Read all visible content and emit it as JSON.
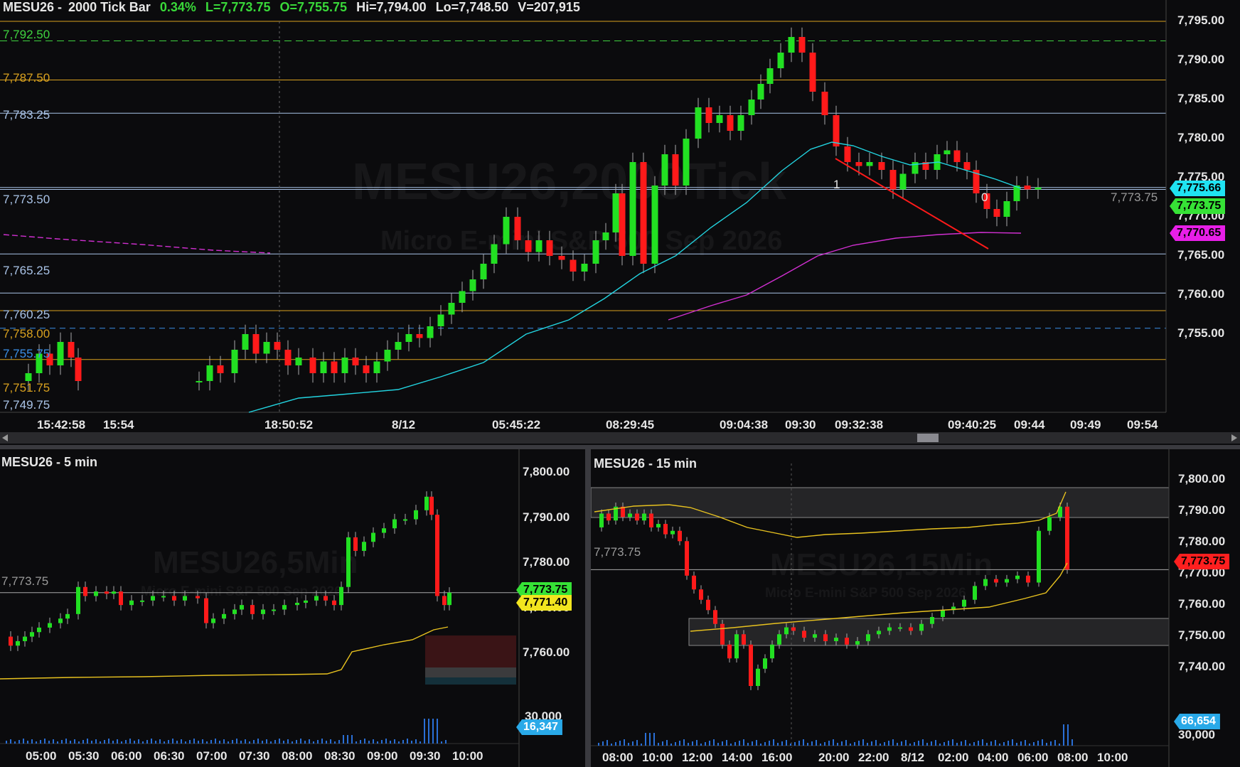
{
  "main": {
    "symbol": "MESU26",
    "interval": "2000 Tick Bar",
    "change_pct": "0.34%",
    "last": "L=7,773.75",
    "open": "O=7,755.75",
    "high": "Hi=7,794.00",
    "low": "Lo=7,748.50",
    "volume": "V=207,915",
    "watermark_title": "MESU26,2000Tick",
    "watermark_sub": "Micro E-mini S&P 500 Sep 2026",
    "y_ticks": [
      "7,795.00",
      "7,790.00",
      "7,785.00",
      "7,780.00",
      "7,775.00",
      "7,770.00",
      "7,765.00",
      "7,760.00",
      "7,755.00"
    ],
    "x_ticks": [
      "15:42:58",
      "15:54",
      "18:50:52",
      "8/12",
      "05:45:22",
      "08:29:45",
      "09:04:38",
      "09:30",
      "09:32:38",
      "09:40:25",
      "09:44",
      "09:49",
      "09:54"
    ],
    "levels": [
      {
        "label": "7,792.50",
        "color": "#3fd33f"
      },
      {
        "label": "7,787.50",
        "color": "#d9a11f"
      },
      {
        "label": "7,783.25",
        "color": "#aac4e8"
      },
      {
        "label": "7,773.50",
        "color": "#aac4e8"
      },
      {
        "label": "7,765.25",
        "color": "#aac4e8"
      },
      {
        "label": "7,760.25",
        "color": "#aac4e8"
      },
      {
        "label": "7,758.00",
        "color": "#d9a11f"
      },
      {
        "label": "7,755.75",
        "color": "#3b8fe8"
      },
      {
        "label": "7,751.75",
        "color": "#d9a11f"
      },
      {
        "label": "7,749.75",
        "color": "#aac4e8"
      }
    ],
    "last_price_text": "7,773.75",
    "tag_cyan": "7,775.66",
    "tag_green": "7,773.75",
    "tag_magenta": "7,770.65",
    "swing_labels": [
      "1",
      "0"
    ]
  },
  "left": {
    "title": "MESU26 - 5 min",
    "watermark_title": "MESU26,5Min",
    "watermark_sub": "Micro E-mini S&P 500 Sep 2026",
    "y_ticks": [
      "7,800.00",
      "7,790.00",
      "7,780.00",
      "7,770.00",
      "7,760.00"
    ],
    "vol_tick": "30,000",
    "x_ticks": [
      "05:00",
      "05:30",
      "06:00",
      "06:30",
      "07:00",
      "07:30",
      "08:00",
      "08:30",
      "09:00",
      "09:30",
      "10:00"
    ],
    "price_line_label": "7,773.75",
    "tag_green": "7,773.75",
    "tag_yellow": "7,771.40",
    "tag_vol": "16,347"
  },
  "right": {
    "title": "MESU26 - 15 min",
    "watermark_title": "MESU26,15Min",
    "watermark_sub": "Micro E-mini S&P 500 Sep 2026",
    "y_ticks": [
      "7,800.00",
      "7,790.00",
      "7,780.00",
      "7,770.00",
      "7,760.00",
      "7,750.00",
      "7,740.00"
    ],
    "vol_tick": "30,000",
    "x_ticks": [
      "08:00",
      "10:00",
      "12:00",
      "14:00",
      "16:00",
      "20:00",
      "22:00",
      "8/12",
      "02:00",
      "04:00",
      "06:00",
      "08:00",
      "10:00"
    ],
    "price_line_label": "7,773.75",
    "tag_red": "7,773.75",
    "tag_vol": "66,654"
  }
}
